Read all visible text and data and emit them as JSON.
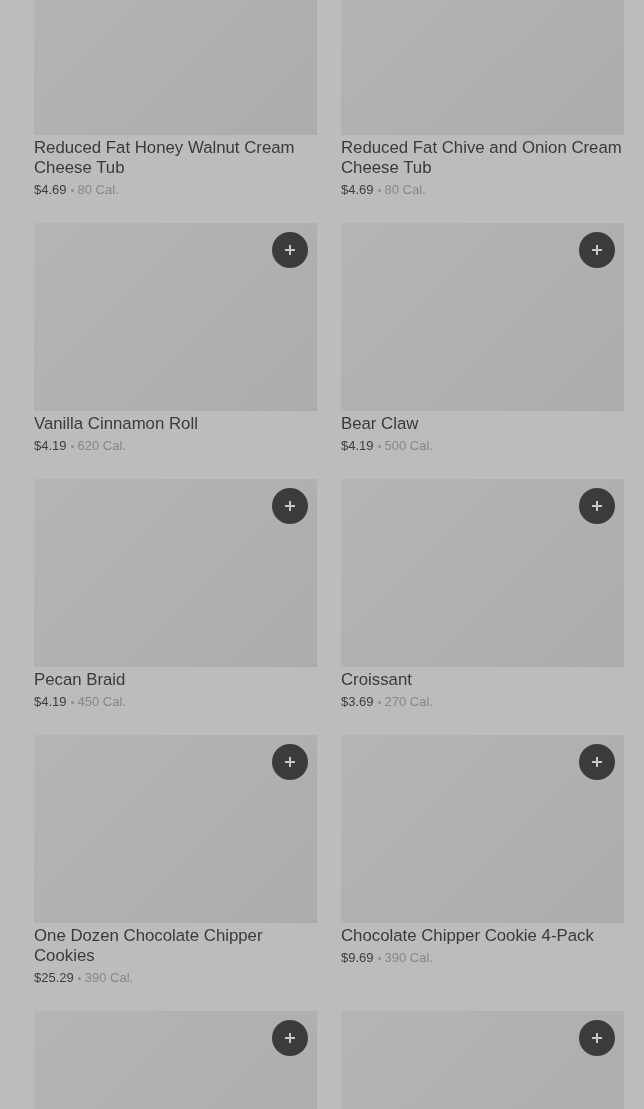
{
  "items": [
    {
      "kind": "full",
      "name": "Reduced Fat Honey Walnut Cream Cheese Tub",
      "price": "$4.69",
      "calories": "80 Cal."
    },
    {
      "kind": "full",
      "name": "Reduced Fat Chive and Onion Cream Cheese Tub",
      "price": "$4.69",
      "calories": "80 Cal."
    },
    {
      "kind": "full",
      "name": "Vanilla Cinnamon Roll",
      "price": "$4.19",
      "calories": "620 Cal."
    },
    {
      "kind": "full",
      "name": "Bear Claw",
      "price": "$4.19",
      "calories": "500 Cal."
    },
    {
      "kind": "full",
      "name": "Pecan Braid",
      "price": "$4.19",
      "calories": "450 Cal."
    },
    {
      "kind": "full",
      "name": "Croissant",
      "price": "$3.69",
      "calories": "270 Cal."
    },
    {
      "kind": "full",
      "name": "One Dozen Chocolate Chipper Cookies",
      "price": "$25.29",
      "calories": "390 Cal."
    },
    {
      "kind": "full",
      "name": "Chocolate Chipper Cookie 4-Pack",
      "price": "$9.69",
      "calories": "390 Cal."
    },
    {
      "kind": "image_only"
    },
    {
      "kind": "image_only"
    }
  ]
}
